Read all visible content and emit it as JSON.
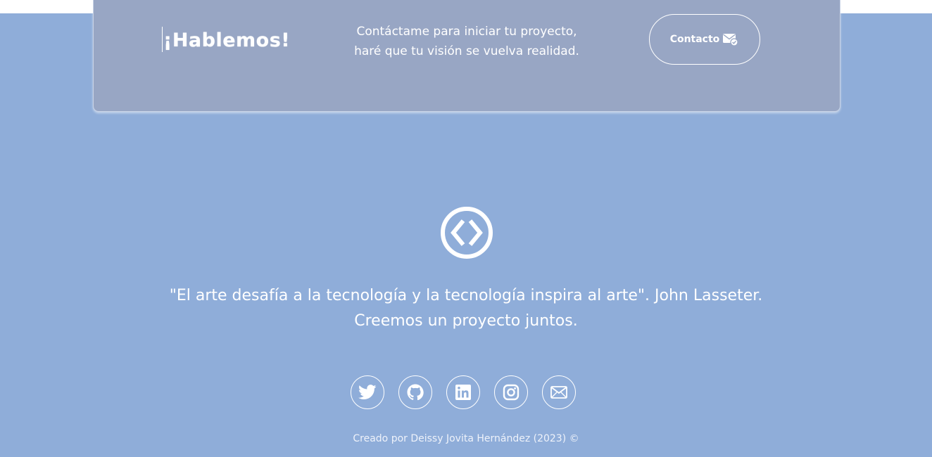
{
  "cta": {
    "title": "¡Hablemos!",
    "text_line1": "Contáctame para iniciar tu proyecto,",
    "text_line2": "haré que tu visión se vuelva realidad.",
    "contact_label": "Contacto"
  },
  "quote": {
    "line1": "\"El arte desafía a la tecnología y la tecnología inspira al arte\". John Lasseter.",
    "line2": "Creemos un proyecto juntos."
  },
  "socials": [
    {
      "icon": "twitter-icon"
    },
    {
      "icon": "github-icon"
    },
    {
      "icon": "linkedin-icon"
    },
    {
      "icon": "instagram-icon"
    },
    {
      "icon": "envelope-icon"
    }
  ],
  "footer": {
    "credit": "Creado por Deissy Jovita Hernández (2023) ©"
  },
  "colors": {
    "page_background": "#8fadd9",
    "card_background": "#98a6c4",
    "text": "#ffffff"
  }
}
